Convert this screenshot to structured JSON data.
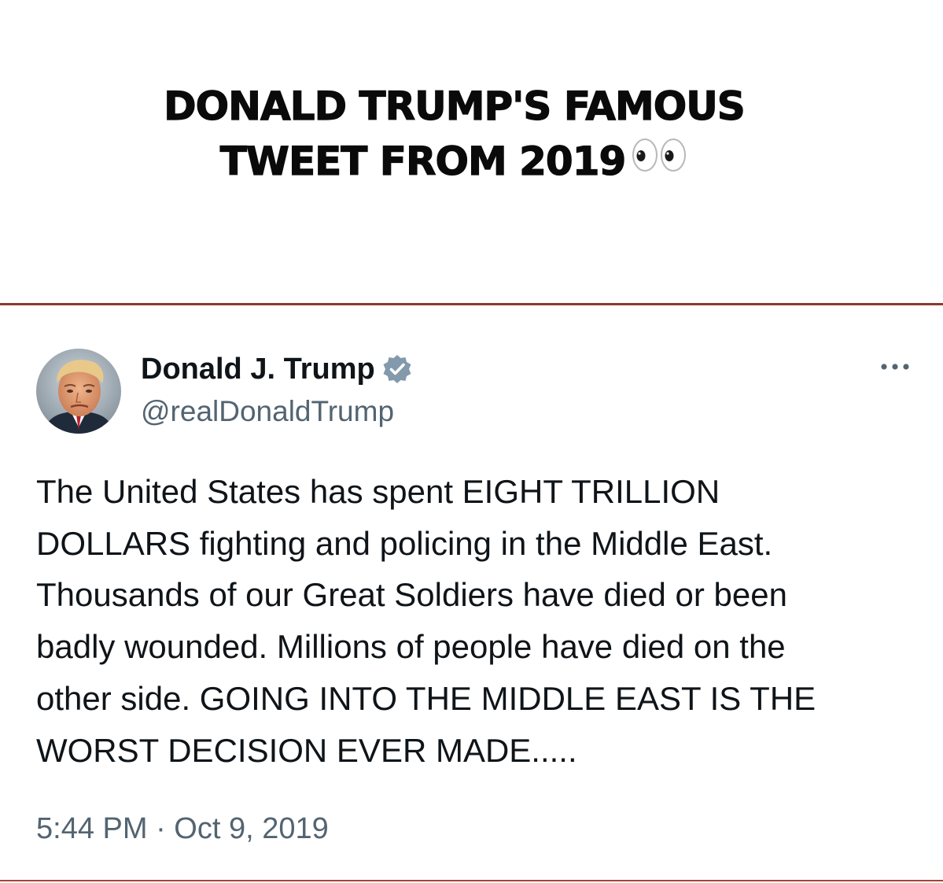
{
  "headline": {
    "line1": "DONALD TRUMP'S FAMOUS",
    "line2": "TWEET FROM 2019",
    "emoji_icon": "eyes-emoji"
  },
  "tweet": {
    "author": {
      "display_name": "Donald J. Trump",
      "handle": "@realDonaldTrump",
      "verified": true,
      "verified_color": "#829aab",
      "avatar_icon": "profile-photo"
    },
    "more_icon": "more-options-icon",
    "text_lines": [
      "The United States has spent EIGHT TRILLION",
      "DOLLARS fighting and policing in the Middle East.",
      "Thousands of our Great Soldiers have died or been",
      "badly wounded. Millions of people have died on the",
      "other side. GOING INTO THE MIDDLE EAST IS THE",
      "WORST DECISION EVER MADE....."
    ],
    "timestamp": "5:44 PM · Oct 9, 2019"
  },
  "colors": {
    "divider": "#8b3a2e",
    "secondary_text": "#536471",
    "primary_text": "#0f1419"
  }
}
